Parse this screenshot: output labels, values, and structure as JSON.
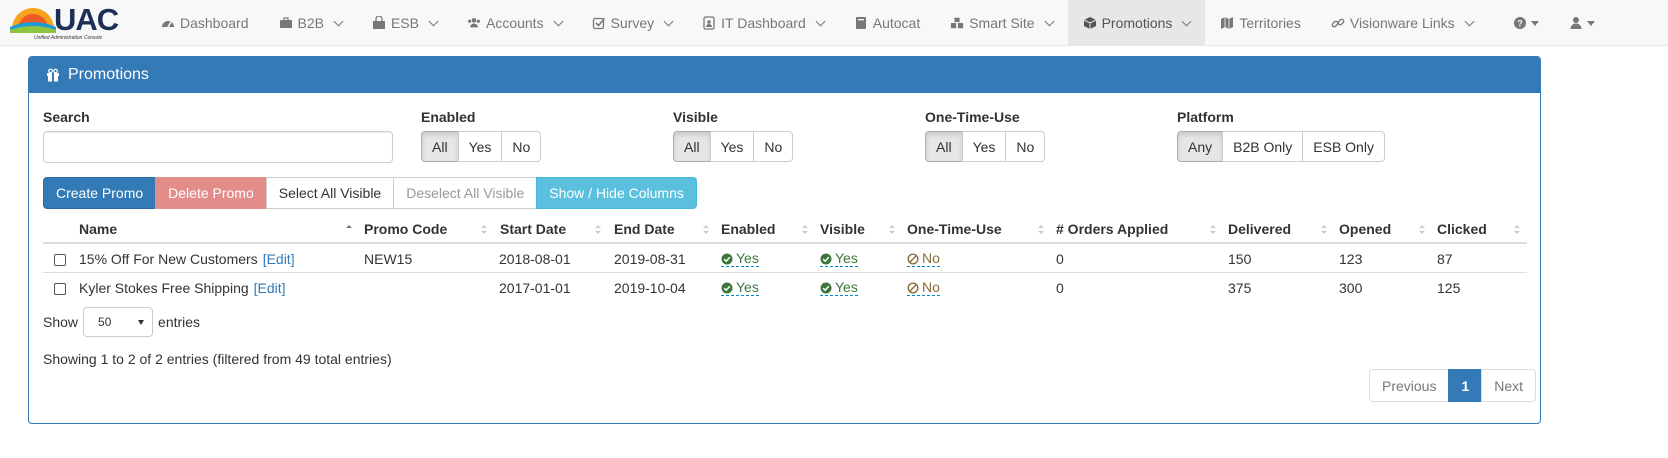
{
  "brand": {
    "name": "UAC",
    "subtitle": "Unified Administration Console"
  },
  "nav": {
    "items": [
      {
        "label": "Dashboard",
        "icon": "dashboard-icon"
      },
      {
        "label": "B2B",
        "icon": "briefcase-icon"
      },
      {
        "label": "ESB",
        "icon": "shopping-bag-icon"
      },
      {
        "label": "Accounts",
        "icon": "users-icon"
      },
      {
        "label": "Survey",
        "icon": "check-square-icon"
      },
      {
        "label": "IT Dashboard",
        "icon": "id-badge-icon"
      },
      {
        "label": "Autocat",
        "icon": "book-icon"
      },
      {
        "label": "Smart Site",
        "icon": "cubes-icon"
      },
      {
        "label": "Promotions",
        "icon": "cube-icon"
      },
      {
        "label": "Territories",
        "icon": "map-icon"
      },
      {
        "label": "Visionware Links",
        "icon": "link-icon"
      }
    ],
    "help_icon": "question-circle-icon",
    "user_icon": "user-icon"
  },
  "panel": {
    "title": "Promotions",
    "icon": "gift-icon"
  },
  "filters": {
    "search_label": "Search",
    "search_value": "",
    "enabled": {
      "label": "Enabled",
      "options": [
        "All",
        "Yes",
        "No"
      ],
      "selected": "All"
    },
    "visible": {
      "label": "Visible",
      "options": [
        "All",
        "Yes",
        "No"
      ],
      "selected": "All"
    },
    "one_time_use": {
      "label": "One-Time-Use",
      "options": [
        "All",
        "Yes",
        "No"
      ],
      "selected": "All"
    },
    "platform": {
      "label": "Platform",
      "options": [
        "Any",
        "B2B Only",
        "ESB Only"
      ],
      "selected": "Any"
    }
  },
  "actions": {
    "create": "Create Promo",
    "delete": "Delete Promo",
    "select_all": "Select All Visible",
    "deselect_all": "Deselect All Visible",
    "show_hide": "Show / Hide Columns"
  },
  "table": {
    "columns": [
      "Name",
      "Promo Code",
      "Start Date",
      "End Date",
      "Enabled",
      "Visible",
      "One-Time-Use",
      "# Orders Applied",
      "Delivered",
      "Opened",
      "Clicked"
    ],
    "edit_label": "[Edit]",
    "rows": [
      {
        "name": "15% Off For New Customers",
        "promo_code": "NEW15",
        "start_date": "2018-08-01",
        "end_date": "2019-08-31",
        "enabled": "Yes",
        "visible": "Yes",
        "one_time_use": "No",
        "orders_applied": "0",
        "delivered": "150",
        "opened": "123",
        "clicked": "87"
      },
      {
        "name": "Kyler Stokes Free Shipping",
        "promo_code": "",
        "start_date": "2017-01-01",
        "end_date": "2019-10-04",
        "enabled": "Yes",
        "visible": "Yes",
        "one_time_use": "No",
        "orders_applied": "0",
        "delivered": "375",
        "opened": "300",
        "clicked": "125"
      }
    ]
  },
  "length": {
    "show": "Show",
    "value": "50",
    "entries": "entries"
  },
  "info": "Showing 1 to 2 of 2 entries (filtered from 49 total entries)",
  "pagination": {
    "previous": "Previous",
    "current": "1",
    "next": "Next"
  },
  "colors": {
    "primary": "#337ab7",
    "danger_light": "#e38d8b",
    "info": "#5bc0de",
    "success_text": "#3c763d"
  }
}
